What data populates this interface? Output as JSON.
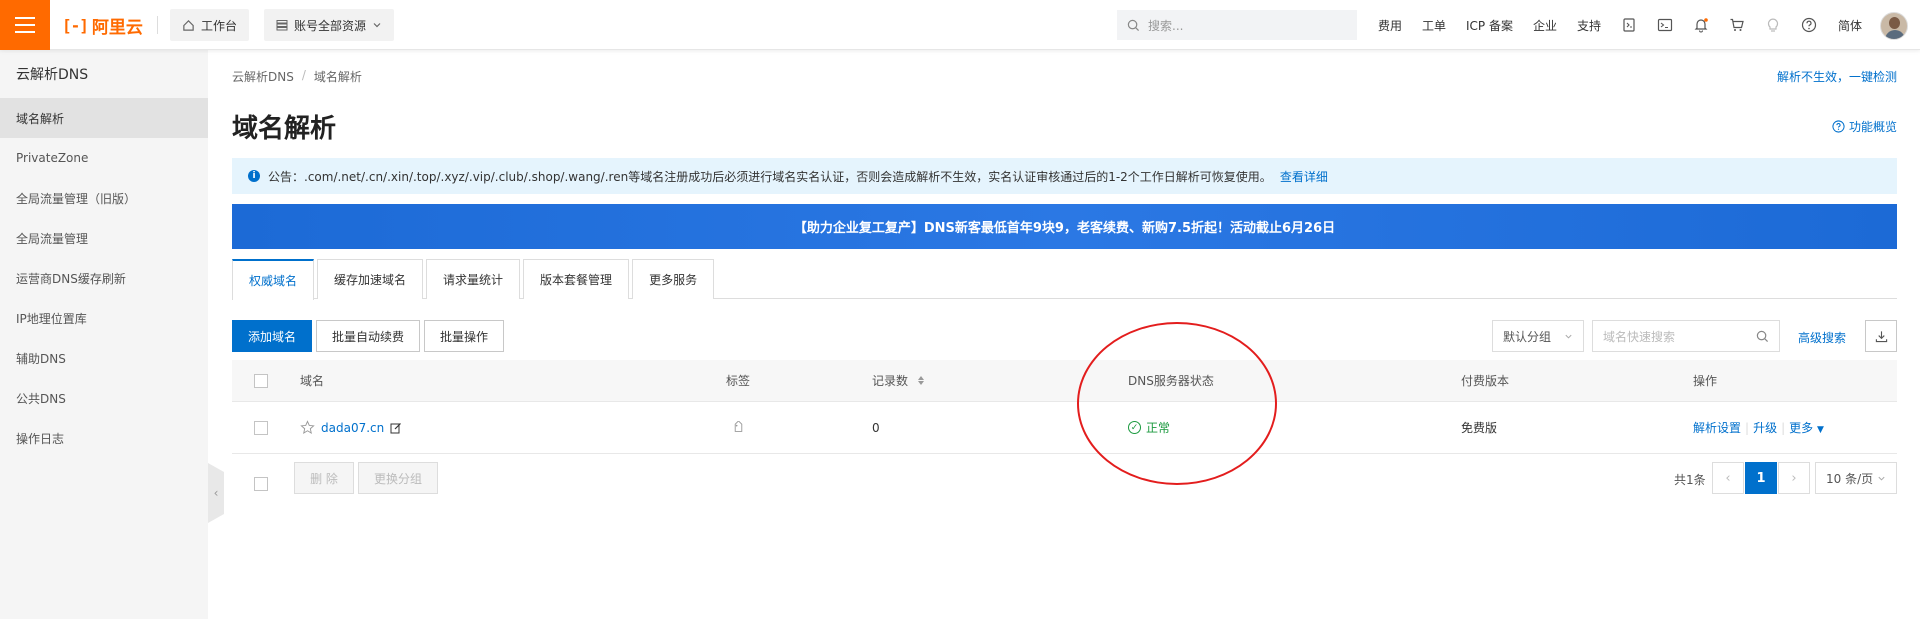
{
  "topbar": {
    "logo_text": "阿里云",
    "workbench": "工作台",
    "resources": "账号全部资源",
    "search_placeholder": "搜索...",
    "links": [
      "费用",
      "工单",
      "ICP 备案",
      "企业",
      "支持"
    ],
    "lang": "简体",
    "brand_color": "#ff6a00"
  },
  "sidebar": {
    "title": "云解析DNS",
    "items": [
      {
        "label": "域名解析",
        "active": true
      },
      {
        "label": "PrivateZone"
      },
      {
        "label": "全局流量管理（旧版）"
      },
      {
        "label": "全局流量管理"
      },
      {
        "label": "运营商DNS缓存刷新"
      },
      {
        "label": "IP地理位置库"
      },
      {
        "label": "辅助DNS"
      },
      {
        "label": "公共DNS"
      },
      {
        "label": "操作日志"
      }
    ]
  },
  "main": {
    "breadcrumb": [
      "云解析DNS",
      "域名解析"
    ],
    "top_right_link": "解析不生效，一键检测",
    "title": "域名解析",
    "overview_link": "功能概览",
    "notice": {
      "text": "公告：.com/.net/.cn/.xin/.top/.xyz/.vip/.club/.shop/.wang/.ren等域名注册成功后必须进行域名实名认证，否则会造成解析不生效，实名认证审核通过后的1-2个工作日解析可恢复使用。",
      "link": "查看详细"
    },
    "banner": "【助力企业复工复产】DNS新客最低首年9块9，老客续费、新购7.5折起！活动截止6月26日",
    "tabs": [
      "权威域名",
      "缓存加速域名",
      "请求量统计",
      "版本套餐管理",
      "更多服务"
    ],
    "toolbar": {
      "add": "添加域名",
      "batch_renew": "批量自动续费",
      "batch_ops": "批量操作",
      "group_select": "默认分组",
      "search_placeholder": "域名快速搜索",
      "advanced": "高级搜索"
    },
    "table": {
      "headers": {
        "domain": "域名",
        "tag": "标签",
        "records": "记录数",
        "dns_status": "DNS服务器状态",
        "edition": "付费版本",
        "ops": "操作"
      },
      "rows": [
        {
          "domain": "dada07.cn",
          "records": "0",
          "status": "正常",
          "edition": "免费版",
          "op_settings": "解析设置",
          "op_upgrade": "升级",
          "op_more": "更多"
        }
      ]
    },
    "footer": {
      "delete": "删 除",
      "change_group": "更换分组",
      "total": "共1条",
      "page": "1",
      "page_size": "10 条/页"
    }
  }
}
